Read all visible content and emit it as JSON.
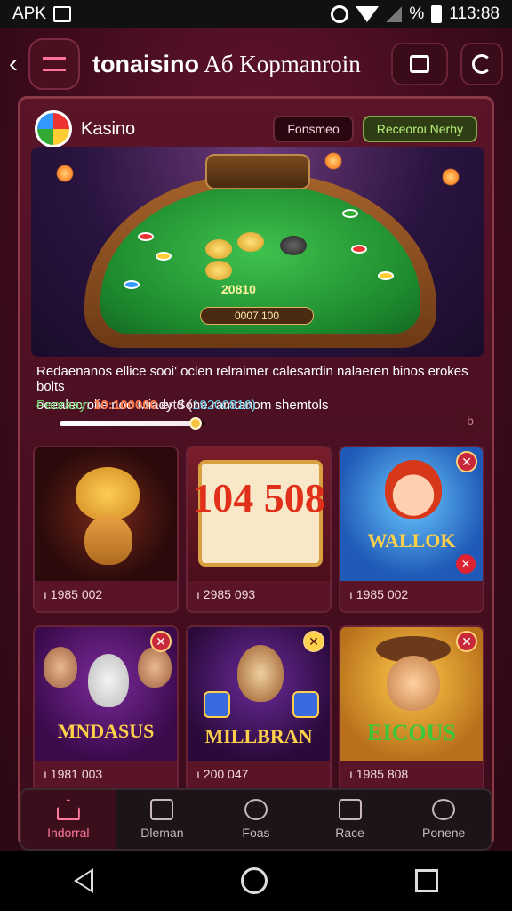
{
  "status_bar": {
    "left_text": "APK",
    "battery_percent": "%",
    "time": "113:88"
  },
  "app_bar": {
    "title_bold": "tonaisino",
    "title_rest": "Aб Kopmanroin"
  },
  "card": {
    "title": "Kasino",
    "pill_1": "Fonsmeo",
    "pill_2": "Receoroi Nerhy"
  },
  "hero": {
    "score": "20810",
    "label": "0007 100"
  },
  "description": {
    "line_1": "Redaenanos ellice sooi' oclen relraimer calesardin nalaeren binos erokes bolts",
    "line_2": "ocealecrolie noo Miady Sone ramtanom shemtols",
    "promo_label": "Peoraay:",
    "promo_code": "10:100000",
    "promo_tail": "ertd (",
    "promo_code_2": "19200816)"
  },
  "progress": {
    "value": 0.93
  },
  "games": [
    {
      "art_text": "",
      "caption": "ı 1985 002",
      "has_close": false,
      "has_fav": false
    },
    {
      "art_text": "104 508",
      "caption": "ı 2985 093",
      "has_close": false,
      "has_fav": false
    },
    {
      "art_text": "WALLOK",
      "caption": "ı 1985 002",
      "has_close": true,
      "has_fav": true
    },
    {
      "art_text": "MNDASUS",
      "caption": "ı 1981 003",
      "has_close": true,
      "has_fav": false
    },
    {
      "art_text": "MILLBRAN",
      "caption": "ı 200 047",
      "has_close": true,
      "has_fav": false
    },
    {
      "art_text": "EICOUS",
      "caption": "ı 1985 808",
      "has_close": true,
      "has_fav": false
    }
  ],
  "bottom_nav": [
    {
      "label": "Indorral",
      "icon": "home-icon",
      "active": true
    },
    {
      "label": "Dleman",
      "icon": "mail-icon",
      "active": false
    },
    {
      "label": "Foas",
      "icon": "chat-icon",
      "active": false
    },
    {
      "label": "Race",
      "icon": "gift-icon",
      "active": false
    },
    {
      "label": "Ponene",
      "icon": "user-icon",
      "active": false
    }
  ],
  "colors": {
    "accent_pink": "#ff6fa0",
    "accent_green": "#7fae45",
    "background": "#4a0f22"
  }
}
